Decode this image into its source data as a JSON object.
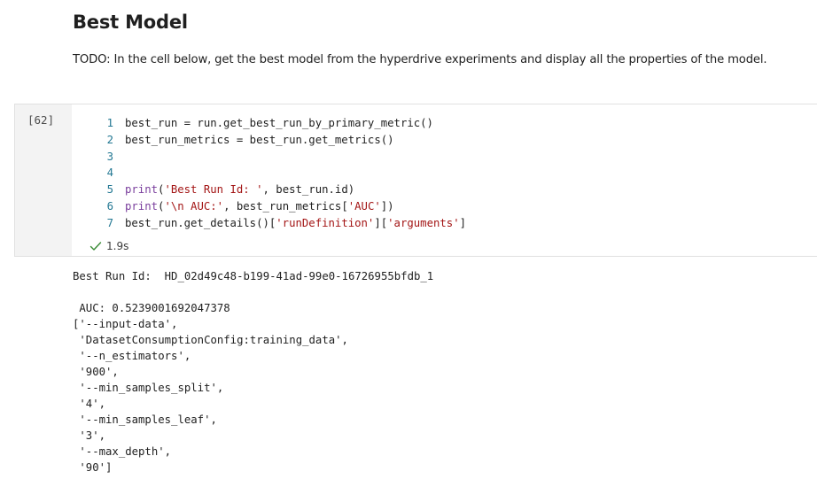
{
  "markdown": {
    "title": "Best Model",
    "text": "TODO: In the cell below, get the best model from the hyperdrive experiments and display all the properties of the model."
  },
  "code_cell": {
    "execution_count": "[62]",
    "lines": [
      {
        "num": "1",
        "segments": [
          {
            "t": "best_run = run.get_best_run_by_primary_metric()",
            "c": "plain"
          }
        ]
      },
      {
        "num": "2",
        "segments": [
          {
            "t": "best_run_metrics = best_run.get_metrics()",
            "c": "plain"
          }
        ]
      },
      {
        "num": "3",
        "segments": []
      },
      {
        "num": "4",
        "segments": []
      },
      {
        "num": "5",
        "segments": [
          {
            "t": "print",
            "c": "kw"
          },
          {
            "t": "(",
            "c": "plain"
          },
          {
            "t": "'Best Run Id: '",
            "c": "str"
          },
          {
            "t": ", best_run.id)",
            "c": "plain"
          }
        ]
      },
      {
        "num": "6",
        "segments": [
          {
            "t": "print",
            "c": "kw"
          },
          {
            "t": "(",
            "c": "plain"
          },
          {
            "t": "'\\n AUC:'",
            "c": "str"
          },
          {
            "t": ", best_run_metrics[",
            "c": "plain"
          },
          {
            "t": "'AUC'",
            "c": "str"
          },
          {
            "t": "])",
            "c": "plain"
          }
        ]
      },
      {
        "num": "7",
        "segments": [
          {
            "t": "best_run.get_details()[",
            "c": "plain"
          },
          {
            "t": "'runDefinition'",
            "c": "str"
          },
          {
            "t": "][",
            "c": "plain"
          },
          {
            "t": "'arguments'",
            "c": "str"
          },
          {
            "t": "]",
            "c": "plain"
          }
        ]
      }
    ],
    "status": {
      "icon": "check-icon",
      "duration": "1.9s",
      "color": "#388a34"
    }
  },
  "output": {
    "lines": [
      "Best Run Id:  HD_02d49c48-b199-41ad-99e0-16726955bfdb_1",
      "",
      " AUC: 0.5239001692047378",
      "['--input-data',",
      " 'DatasetConsumptionConfig:training_data',",
      " '--n_estimators',",
      " '900',",
      " '--min_samples_split',",
      " '4',",
      " '--min_samples_leaf',",
      " '3',",
      " '--max_depth',",
      " '90']"
    ]
  }
}
